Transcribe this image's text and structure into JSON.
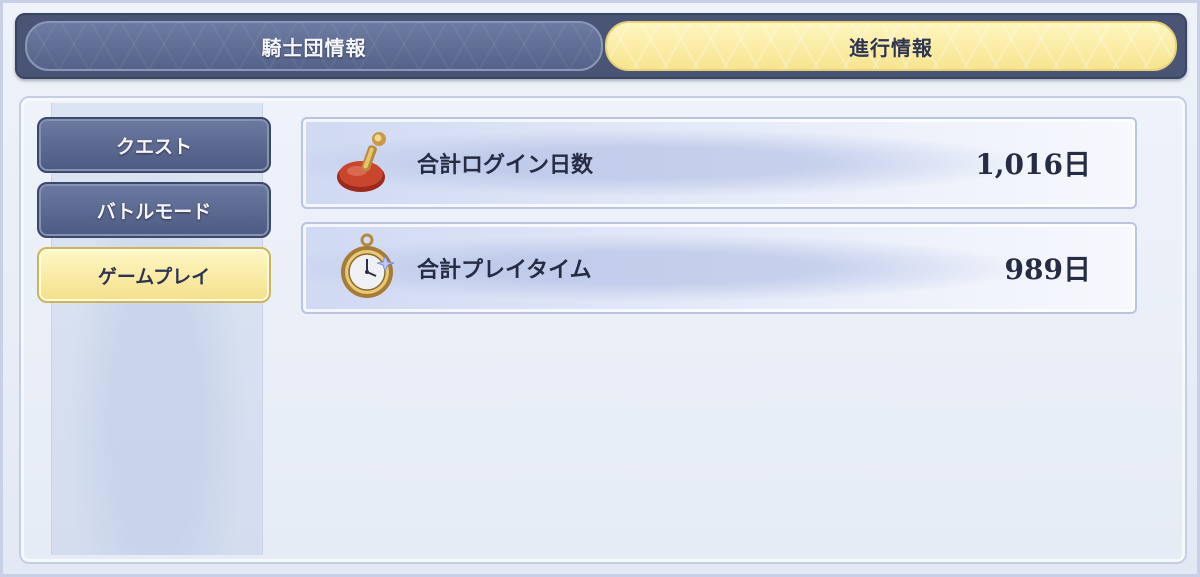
{
  "tabs": [
    {
      "label": "騎士団情報",
      "selected": false
    },
    {
      "label": "進行情報",
      "selected": true
    }
  ],
  "sidebar": {
    "items": [
      {
        "label": "クエスト",
        "selected": false
      },
      {
        "label": "バトルモード",
        "selected": false
      },
      {
        "label": "ゲームプレイ",
        "selected": true
      }
    ]
  },
  "stats": [
    {
      "label": "合計ログイン日数",
      "value": "1,016日",
      "icon": "stamp-seal-icon"
    },
    {
      "label": "合計プレイタイム",
      "value": "989日",
      "icon": "pocket-watch-icon"
    }
  ],
  "colors": {
    "active_gold": "#f6e48f",
    "inactive_navy": "#55628a",
    "text_dark": "#262c44"
  }
}
